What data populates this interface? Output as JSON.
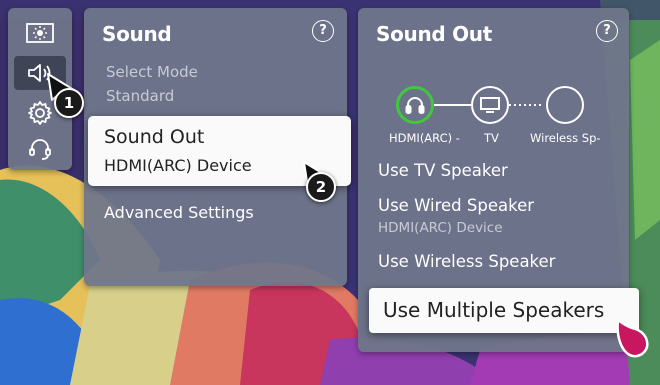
{
  "icon_bar": {
    "items": [
      {
        "icon": "picture-settings-icon"
      },
      {
        "icon": "speaker-icon"
      },
      {
        "icon": "gear-icon"
      },
      {
        "icon": "support-headset-icon"
      }
    ]
  },
  "sound_panel": {
    "title": "Sound",
    "help": "?",
    "select_mode_label": "Select Mode",
    "select_mode_value": "Standard",
    "sound_out_label": "Sound Out",
    "sound_out_value": "HDMI(ARC) Device",
    "advanced_settings": "Advanced Settings"
  },
  "sound_out_panel": {
    "title": "Sound Out",
    "help": "?",
    "devices": [
      {
        "label": "HDMI(ARC) -",
        "icon": "headphones-icon"
      },
      {
        "label": "TV",
        "icon": "tv-icon"
      },
      {
        "label": "Wireless Sp-",
        "icon": "empty-circle"
      }
    ],
    "options": {
      "tv_speaker": "Use TV Speaker",
      "wired_speaker": "Use Wired Speaker",
      "wired_speaker_sub": "HDMI(ARC) Device",
      "wireless_speaker": "Use Wireless Speaker",
      "multiple_speakers": "Use Multiple Speakers"
    }
  },
  "callouts": {
    "step1": "1",
    "step2": "2"
  },
  "colors": {
    "accent_active_ring": "#40c83f",
    "panel": "#70768a",
    "cursor": "#c8175e"
  }
}
